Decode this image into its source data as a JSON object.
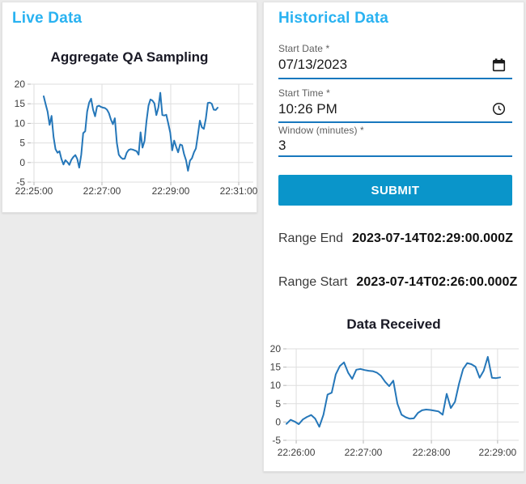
{
  "colors": {
    "accent": "#29b2f1",
    "submit_bg": "#0a95ca",
    "input_underline": "#1878be",
    "chart_line": "#2577b9",
    "page_bg": "#ebebeb"
  },
  "live_panel": {
    "title": "Live Data"
  },
  "historical_panel": {
    "title": "Historical Data",
    "fields": {
      "start_date": {
        "label": "Start Date *",
        "value": "07/13/2023",
        "icon": "calendar-icon"
      },
      "start_time": {
        "label": "Start Time *",
        "value": "10:26 PM",
        "icon": "clock-icon"
      },
      "window": {
        "label": "Window (minutes) *",
        "value": "3"
      }
    },
    "submit_label": "SUBMIT",
    "range_end": {
      "label": "Range End",
      "value": "2023-07-14T02:29:00.000Z"
    },
    "range_start": {
      "label": "Range Start",
      "value": "2023-07-14T02:26:00.000Z"
    }
  },
  "chart_data": [
    {
      "type": "line",
      "title": "Aggregate QA Sampling",
      "xlabel": "",
      "ylabel": "",
      "ylim": [
        -5,
        20
      ],
      "y_ticks": [
        20,
        15,
        10,
        5,
        0,
        -5
      ],
      "x_tick_labels": [
        "22:25:00",
        "22:27:00",
        "22:29:00",
        "22:31:00"
      ],
      "x_data_span": "22:25:17 to 22:30:23",
      "grid": true,
      "legend": false,
      "line_color": "#2577b9",
      "values": [
        16.9,
        14.9,
        13.0,
        9.6,
        11.9,
        6.5,
        3.4,
        2.5,
        2.9,
        0.9,
        -0.5,
        0.6,
        0.1,
        -0.6,
        0.7,
        1.4,
        1.9,
        0.9,
        -1.3,
        2.0,
        7.5,
        8.0,
        13.0,
        15.3,
        16.3,
        13.5,
        11.8,
        14.3,
        14.5,
        14.2,
        14.0,
        13.9,
        13.5,
        12.6,
        11.0,
        9.8,
        11.3,
        5.0,
        2.0,
        1.3,
        0.9,
        1.0,
        2.5,
        3.2,
        3.4,
        3.3,
        3.1,
        2.9,
        2.0,
        7.7,
        3.8,
        5.5,
        10.5,
        14.5,
        16.1,
        15.8,
        15.1,
        12.1,
        14.0,
        17.8,
        12.1,
        12.0,
        12.2,
        10.0,
        7.6,
        3.1,
        5.6,
        4.0,
        2.6,
        4.6,
        4.4,
        2.1,
        0.6,
        -2.1,
        0.5,
        1.1,
        2.6,
        3.6,
        7.1,
        10.7,
        9.0,
        8.6,
        11.1,
        15.2,
        15.3,
        15.0,
        13.5,
        13.4,
        14.0
      ]
    },
    {
      "type": "line",
      "title": "Data Received",
      "xlabel": "",
      "ylabel": "",
      "ylim": [
        -5,
        20
      ],
      "y_ticks": [
        20,
        15,
        10,
        5,
        0,
        -5
      ],
      "x_tick_labels": [
        "22:26:00",
        "22:27:00",
        "22:28:00",
        "22:29:00"
      ],
      "x_data_span": "22:25:51 to 22:28:55",
      "grid": true,
      "legend": false,
      "line_color": "#2577b9",
      "values": [
        -0.5,
        0.6,
        0.1,
        -0.6,
        0.7,
        1.4,
        1.9,
        0.9,
        -1.3,
        2.0,
        7.5,
        8.0,
        13.0,
        15.3,
        16.3,
        13.5,
        11.8,
        14.3,
        14.5,
        14.2,
        14.0,
        13.9,
        13.5,
        12.6,
        11.0,
        9.8,
        11.3,
        5.0,
        2.0,
        1.3,
        0.9,
        1.0,
        2.5,
        3.2,
        3.4,
        3.3,
        3.1,
        2.9,
        2.0,
        7.7,
        3.8,
        5.5,
        10.5,
        14.5,
        16.1,
        15.8,
        15.1,
        12.1,
        14.0,
        17.8,
        12.1,
        12.0,
        12.2
      ]
    }
  ]
}
